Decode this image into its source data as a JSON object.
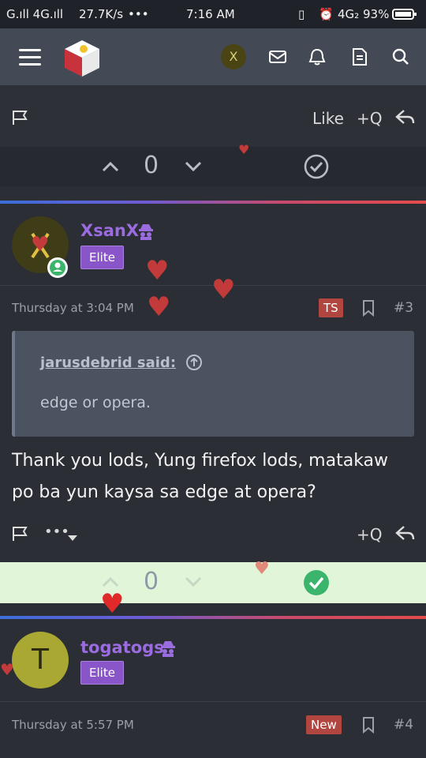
{
  "status_bar": {
    "signal": "G.ıll 4G.ıll",
    "net_speed": "27.7K/s",
    "dots": "•••",
    "time": "7:16 AM",
    "battery_percent": "93%",
    "network_right": "4G₂"
  },
  "header": {
    "avatar_initial": "X"
  },
  "post1": {
    "like_label": "Like",
    "quote_label": "+Q",
    "vote_count": "0"
  },
  "post2": {
    "author": "XsanX",
    "badge": "Elite",
    "time": "Thursday at 3:04 PM",
    "ts_tag": "TS",
    "post_number": "#3",
    "quote": {
      "author": "jarusdebrid said:",
      "text": "edge or opera."
    },
    "body": "Thank you lods, Yung firefox lods, matakaw po ba yun kaysa sa edge at opera?",
    "quote_label": "+Q",
    "more_label": "•••",
    "vote_count": "0"
  },
  "post3": {
    "author": "togatogs",
    "avatar_initial": "T",
    "badge": "Elite",
    "time": "Thursday at 5:57 PM",
    "new_tag": "New",
    "post_number": "#4"
  },
  "colors": {
    "name_purple": "#9b6be0",
    "badge_purple": "#8a55c9",
    "check_green": "#3bb56b",
    "vote_bg_green": "#e1f6d9",
    "heart_red": "#c23a3a"
  }
}
